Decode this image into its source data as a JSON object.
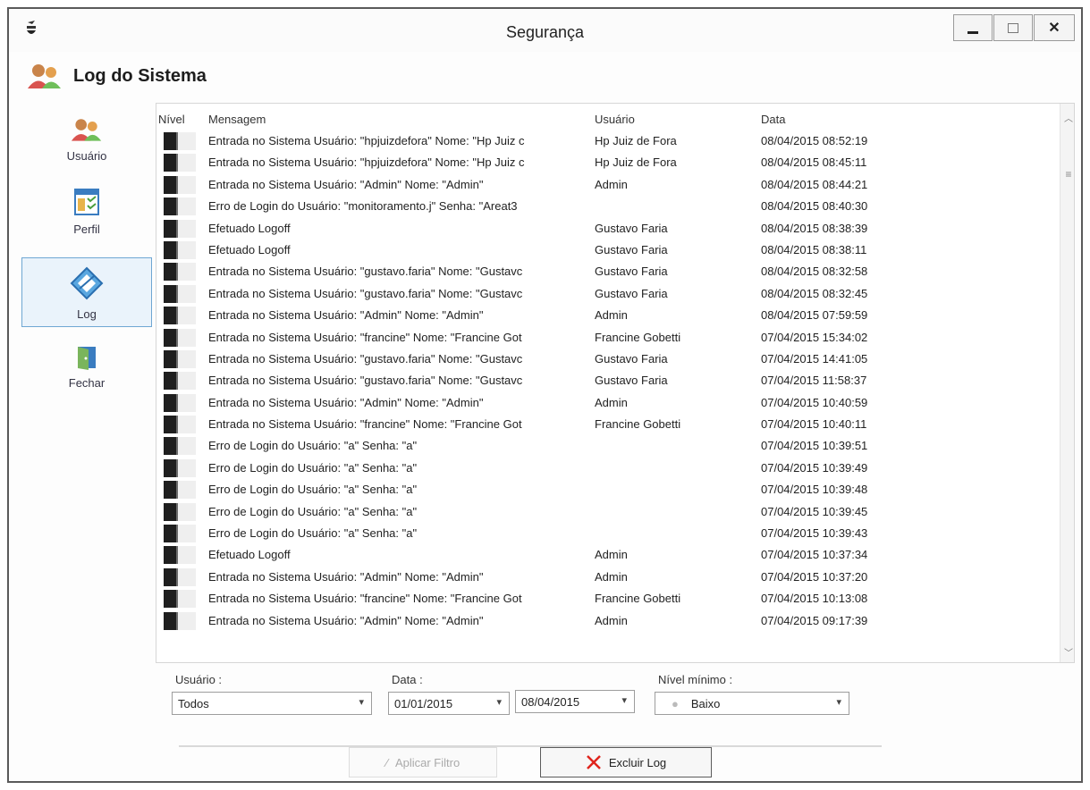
{
  "window": {
    "title": "Segurança"
  },
  "header": {
    "title": "Log do Sistema"
  },
  "sidebar": {
    "items": [
      {
        "label": "Usuário",
        "icon": "users-icon"
      },
      {
        "label": "Perfil",
        "icon": "profile-icon"
      },
      {
        "label": "Log",
        "icon": "log-icon",
        "active": true
      },
      {
        "label": "Fechar",
        "icon": "door-exit-icon"
      }
    ]
  },
  "log_table": {
    "columns": {
      "nivel": "Nível",
      "mensagem": "Mensagem",
      "usuario": "Usuário",
      "data": "Data"
    },
    "rows": [
      {
        "mensagem": "Entrada no Sistema Usuário: \"hpjuizdefora\" Nome: \"Hp Juiz c",
        "usuario": "Hp Juiz de Fora",
        "data": "08/04/2015 08:52:19"
      },
      {
        "mensagem": "Entrada no Sistema Usuário: \"hpjuizdefora\" Nome: \"Hp Juiz c",
        "usuario": "Hp Juiz de Fora",
        "data": "08/04/2015 08:45:11"
      },
      {
        "mensagem": "Entrada no Sistema Usuário: \"Admin\" Nome: \"Admin\"",
        "usuario": "Admin",
        "data": "08/04/2015 08:44:21"
      },
      {
        "mensagem": "Erro de Login do Usuário: \"monitoramento.j\"   Senha: \"Areat3",
        "usuario": "",
        "data": "08/04/2015 08:40:30"
      },
      {
        "mensagem": "Efetuado Logoff",
        "usuario": "Gustavo Faria",
        "data": "08/04/2015 08:38:39"
      },
      {
        "mensagem": "Efetuado Logoff",
        "usuario": "Gustavo Faria",
        "data": "08/04/2015 08:38:11"
      },
      {
        "mensagem": "Entrada no Sistema Usuário: \"gustavo.faria\" Nome: \"Gustavc",
        "usuario": "Gustavo Faria",
        "data": "08/04/2015 08:32:58"
      },
      {
        "mensagem": "Entrada no Sistema Usuário: \"gustavo.faria\" Nome: \"Gustavc",
        "usuario": "Gustavo Faria",
        "data": "08/04/2015 08:32:45"
      },
      {
        "mensagem": "Entrada no Sistema Usuário: \"Admin\" Nome: \"Admin\"",
        "usuario": "Admin",
        "data": "08/04/2015 07:59:59"
      },
      {
        "mensagem": "Entrada no Sistema Usuário: \"francine\" Nome: \"Francine Got",
        "usuario": "Francine Gobetti",
        "data": "07/04/2015 15:34:02"
      },
      {
        "mensagem": "Entrada no Sistema Usuário: \"gustavo.faria\" Nome: \"Gustavc",
        "usuario": "Gustavo Faria",
        "data": "07/04/2015 14:41:05"
      },
      {
        "mensagem": "Entrada no Sistema Usuário: \"gustavo.faria\" Nome: \"Gustavc",
        "usuario": "Gustavo Faria",
        "data": "07/04/2015 11:58:37"
      },
      {
        "mensagem": "Entrada no Sistema Usuário: \"Admin\" Nome: \"Admin\"",
        "usuario": "Admin",
        "data": "07/04/2015 10:40:59"
      },
      {
        "mensagem": "Entrada no Sistema Usuário: \"francine\" Nome: \"Francine Got",
        "usuario": "Francine Gobetti",
        "data": "07/04/2015 10:40:11"
      },
      {
        "mensagem": "Erro de Login do Usuário: \"a\"   Senha: \"a\"",
        "usuario": "",
        "data": "07/04/2015 10:39:51"
      },
      {
        "mensagem": "Erro de Login do Usuário: \"a\"   Senha: \"a\"",
        "usuario": "",
        "data": "07/04/2015 10:39:49"
      },
      {
        "mensagem": "Erro de Login do Usuário: \"a\"   Senha: \"a\"",
        "usuario": "",
        "data": "07/04/2015 10:39:48"
      },
      {
        "mensagem": "Erro de Login do Usuário: \"a\"   Senha: \"a\"",
        "usuario": "",
        "data": "07/04/2015 10:39:45"
      },
      {
        "mensagem": "Erro de Login do Usuário: \"a\"   Senha: \"a\"",
        "usuario": "",
        "data": "07/04/2015 10:39:43"
      },
      {
        "mensagem": "Efetuado Logoff",
        "usuario": "Admin",
        "data": "07/04/2015 10:37:34"
      },
      {
        "mensagem": "Entrada no Sistema Usuário: \"Admin\" Nome: \"Admin\"",
        "usuario": "Admin",
        "data": "07/04/2015 10:37:20"
      },
      {
        "mensagem": "Entrada no Sistema Usuário: \"francine\" Nome: \"Francine Got",
        "usuario": "Francine Gobetti",
        "data": "07/04/2015 10:13:08"
      },
      {
        "mensagem": "Entrada no Sistema Usuário: \"Admin\" Nome: \"Admin\"",
        "usuario": "Admin",
        "data": "07/04/2015 09:17:39"
      }
    ]
  },
  "filters": {
    "usuario": {
      "label": "Usuário :",
      "value": "Todos"
    },
    "data": {
      "label": "Data :",
      "from": "01/01/2015",
      "to": "08/04/2015"
    },
    "nivel": {
      "label": "Nível mínimo :",
      "value": "Baixo"
    }
  },
  "buttons": {
    "apply": "Aplicar Filtro",
    "delete": "Excluir Log"
  },
  "colors": {
    "delete_icon": "#e0241c",
    "selection_border": "#6fa7d3",
    "level_indicator": "#1f1f1f"
  }
}
